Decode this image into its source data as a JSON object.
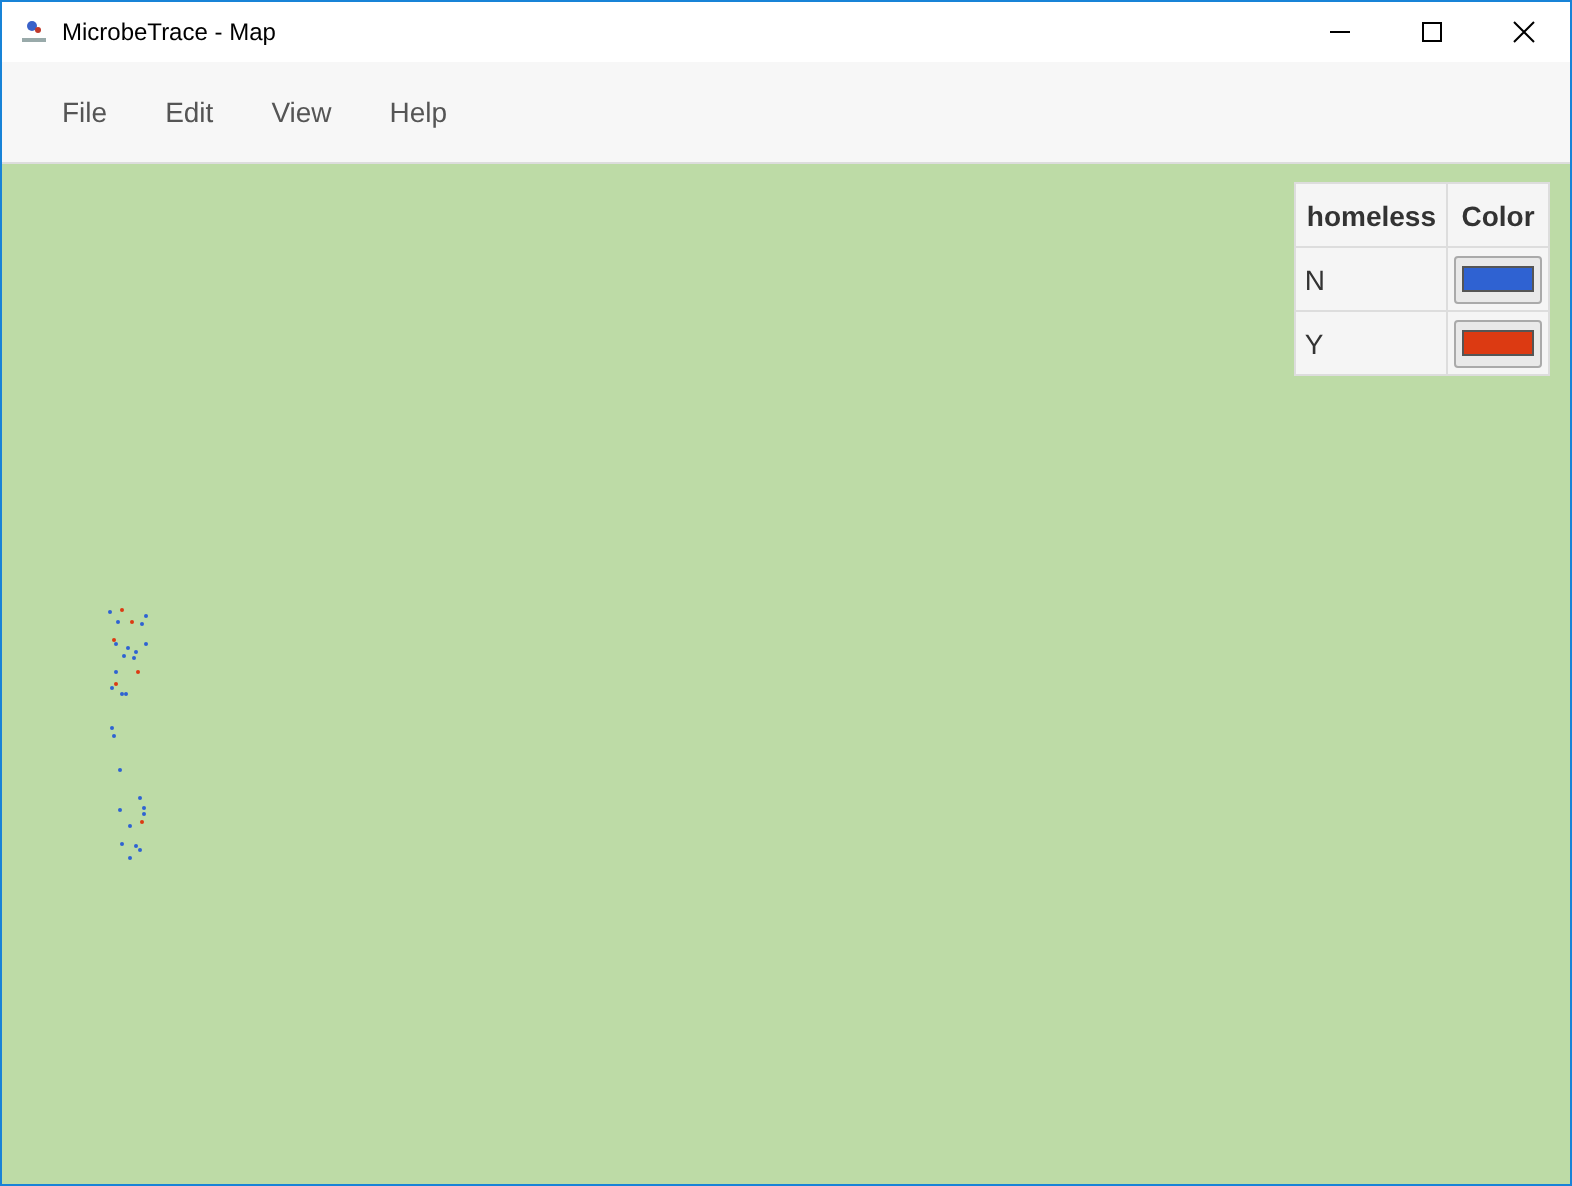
{
  "window": {
    "title": "MicrobeTrace - Map"
  },
  "menu": [
    "File",
    "Edit",
    "View",
    "Help"
  ],
  "legend": {
    "columns": [
      "homeless",
      "Color"
    ],
    "rows": [
      {
        "value": "N",
        "color": "#2f62d2"
      },
      {
        "value": "Y",
        "color": "#dc3a12"
      }
    ]
  }
}
